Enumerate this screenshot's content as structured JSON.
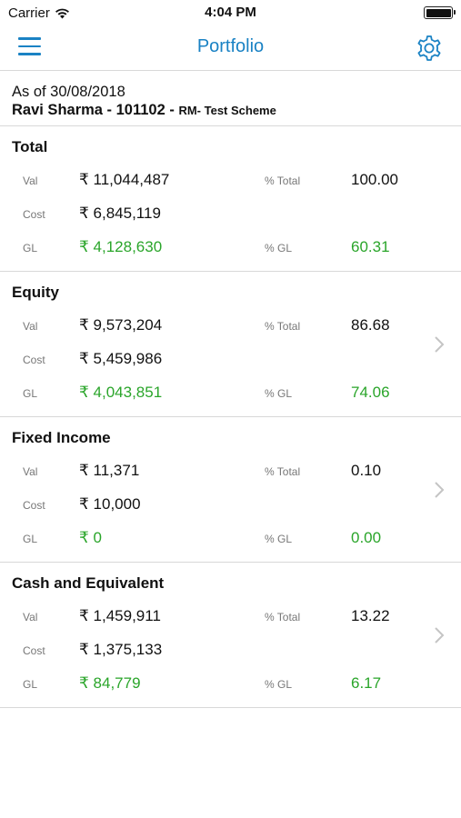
{
  "status_bar": {
    "carrier": "Carrier",
    "time": "4:04 PM"
  },
  "nav": {
    "title": "Portfolio"
  },
  "header": {
    "as_of": "As of 30/08/2018",
    "client": "Ravi Sharma - 101102 - ",
    "scheme": "RM- Test Scheme"
  },
  "labels": {
    "val": "Val",
    "cost": "Cost",
    "gl": "GL",
    "pct_total": "% Total",
    "pct_gl": "% GL"
  },
  "colors": {
    "accent": "#1a82c4",
    "gain": "#2aa52a"
  },
  "sections": [
    {
      "title": "Total",
      "val": "₹ 11,044,487",
      "cost": "₹ 6,845,119",
      "gl": "₹ 4,128,630",
      "pct_total": "100.00",
      "pct_gl": "60.31"
    },
    {
      "title": "Equity",
      "val": "₹ 9,573,204",
      "cost": "₹ 5,459,986",
      "gl": "₹ 4,043,851",
      "pct_total": "86.68",
      "pct_gl": "74.06"
    },
    {
      "title": "Fixed Income",
      "val": "₹ 11,371",
      "cost": "₹ 10,000",
      "gl": "₹ 0",
      "pct_total": "0.10",
      "pct_gl": "0.00"
    },
    {
      "title": "Cash and Equivalent",
      "val": "₹ 1,459,911",
      "cost": "₹ 1,375,133",
      "gl": "₹ 84,779",
      "pct_total": "13.22",
      "pct_gl": "6.17"
    }
  ]
}
